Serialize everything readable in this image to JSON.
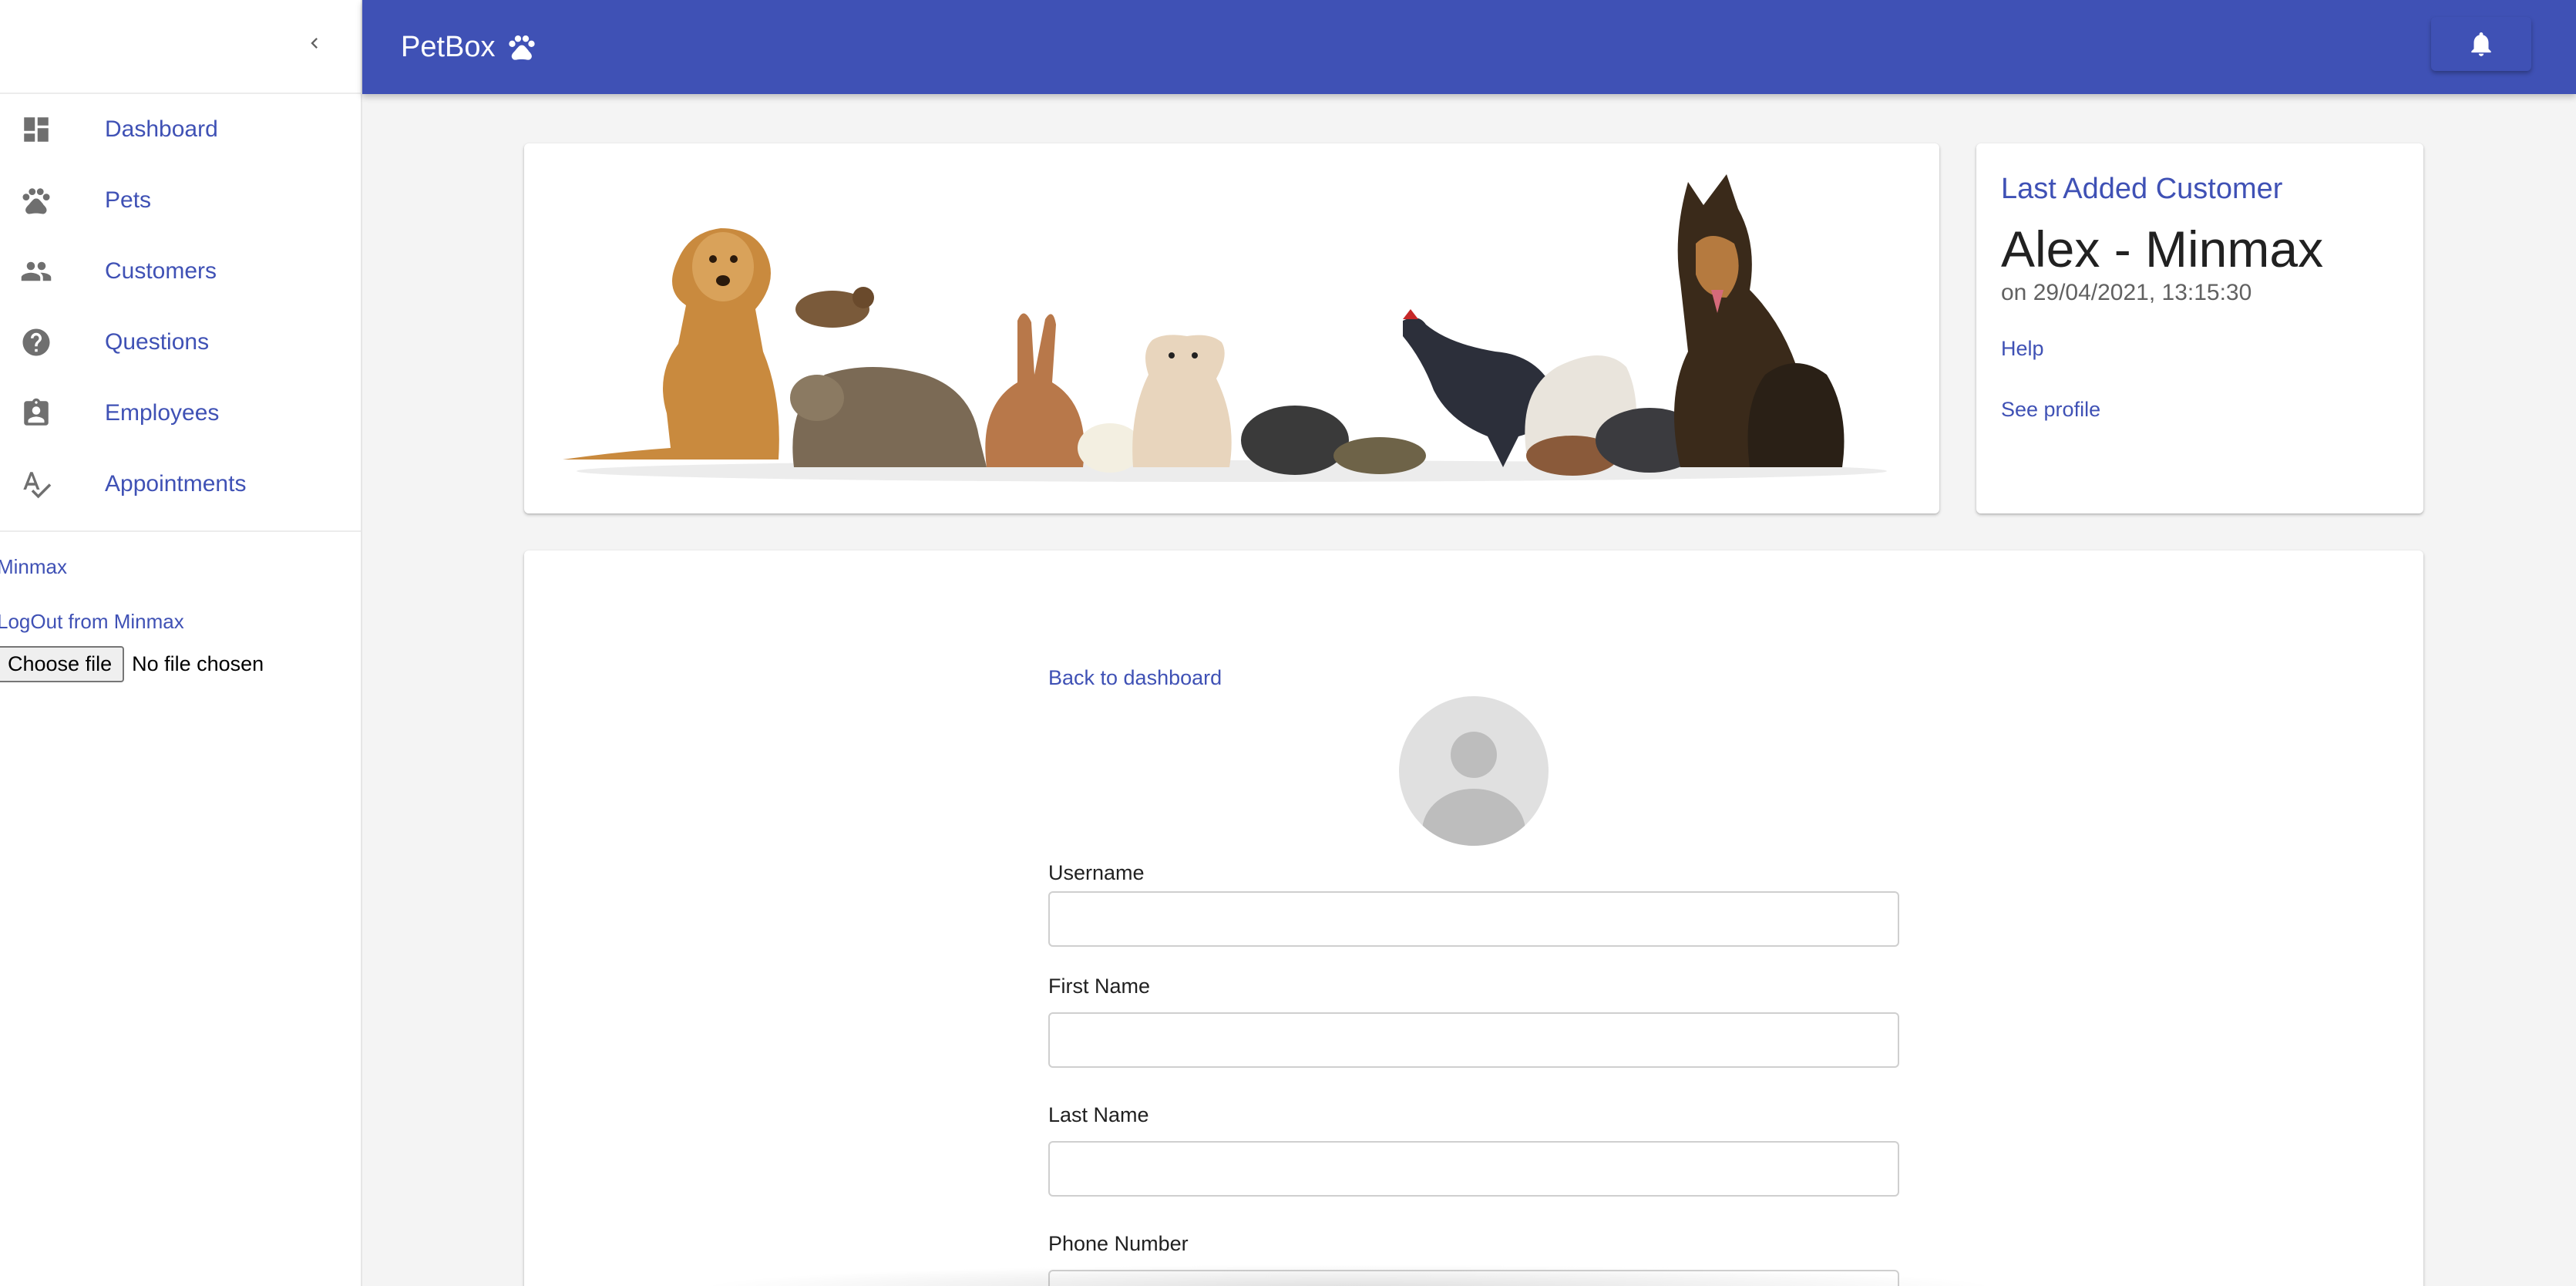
{
  "app": {
    "brand": "PetBox"
  },
  "sidebar": {
    "items": [
      {
        "label": "Dashboard",
        "icon": "dashboard-icon"
      },
      {
        "label": "Pets",
        "icon": "paw-icon"
      },
      {
        "label": "Customers",
        "icon": "people-icon"
      },
      {
        "label": "Questions",
        "icon": "help-circle-icon"
      },
      {
        "label": "Employees",
        "icon": "badge-icon"
      },
      {
        "label": "Appointments",
        "icon": "spellcheck-icon"
      }
    ],
    "user_link": "Minmax",
    "logout_link": "LogOut from Minmax",
    "file_button": "Choose file",
    "file_status": "No file chosen"
  },
  "header": {
    "notifications_icon": "bell-icon"
  },
  "last_customer": {
    "heading": "Last Added Customer",
    "name": "Alex - Minmax",
    "date": "on 29/04/2021, 13:15:30",
    "help_link": "Help",
    "profile_link": "See profile"
  },
  "form": {
    "back_link": "Back to dashboard",
    "username_label": "Username",
    "username_value": "",
    "first_name_label": "First Name",
    "first_name_value": "",
    "last_name_label": "Last Name",
    "last_name_value": "",
    "phone_label": "Phone Number",
    "phone_value": ""
  },
  "colors": {
    "primary": "#3f51b5",
    "background": "#f4f4f4",
    "icon_grey": "#6f6f6f"
  }
}
